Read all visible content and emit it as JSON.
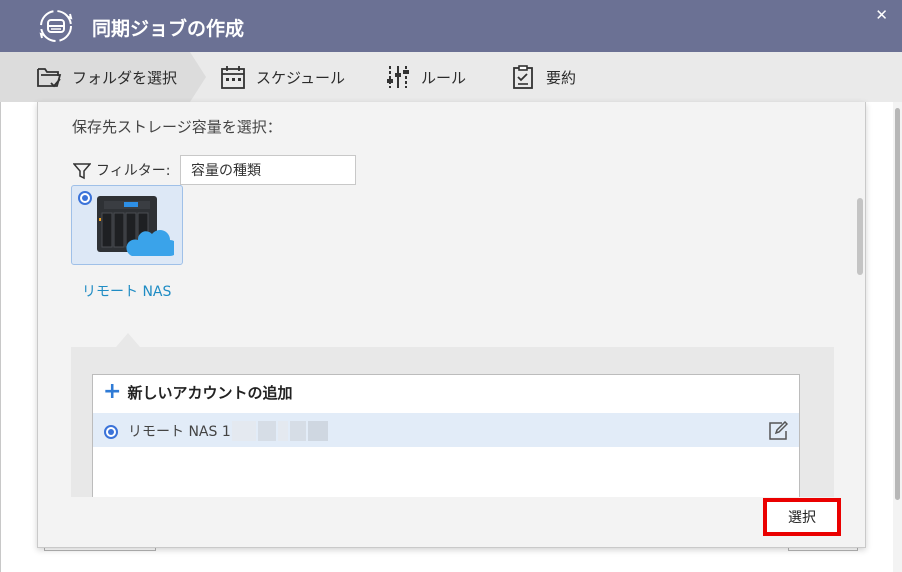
{
  "window": {
    "title": "同期ジョブの作成",
    "close_glyph": "✕",
    "title_icon": "sync-drive-icon"
  },
  "steps": [
    {
      "label": "フォルダを選択",
      "icon": "folder-check-icon",
      "active": true
    },
    {
      "label": "スケジュール",
      "icon": "calendar-icon",
      "active": false
    },
    {
      "label": "ルール",
      "icon": "sliders-icon",
      "active": false
    },
    {
      "label": "要約",
      "icon": "clipboard-icon",
      "active": false
    }
  ],
  "popup": {
    "title": "保存先ストレージ容量を選択：",
    "filter": {
      "label": "フィルター:",
      "value": "容量の種類"
    },
    "storage_option": {
      "caption": "リモート NAS",
      "selected": true
    },
    "accounts": {
      "add_label": "新しいアカウントの追加",
      "items": [
        {
          "label": "リモート NAS 1",
          "selected": true
        }
      ]
    },
    "select_button": "選択"
  },
  "colors": {
    "titlebar": "#6b7194",
    "accent": "#3b73d9",
    "caption_blue": "#1f8cc4",
    "highlight_red": "#ea0000"
  }
}
